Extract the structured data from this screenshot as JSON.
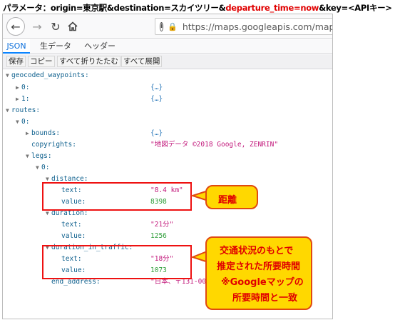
{
  "caption": {
    "prefix": "パラメータ：origin=東京駅&destination=スカイツリー&",
    "highlight": "departure_time=now",
    "suffix": "&key=<APIキー>"
  },
  "toolbar": {
    "back_icon": "arrow-left-icon",
    "forward_icon": "arrow-right-icon",
    "reload_icon": "reload-icon",
    "home_icon": "home-icon",
    "url": "https://maps.googleapis.com/maps"
  },
  "tabs": [
    "JSON",
    "生データ",
    "ヘッダー"
  ],
  "actions": [
    "保存",
    "コピー",
    "すべて折りたたむ",
    "すべて展開"
  ],
  "tree": {
    "geocoded_waypoints": "geocoded_waypoints:",
    "w0": "0:",
    "w0_val": "{…}",
    "w1": "1:",
    "w1_val": "{…}",
    "routes": "routes:",
    "r0": "0:",
    "bounds": "bounds:",
    "bounds_val": "{…}",
    "copyrights": "copyrights:",
    "copyrights_val": "\"地図データ ©2018 Google, ZENRIN\"",
    "legs": "legs:",
    "l0": "0:",
    "distance": "distance:",
    "dist_text": "text:",
    "dist_text_val": "\"8.4 km\"",
    "dist_value": "value:",
    "dist_value_val": "8398",
    "duration": "duration:",
    "dur_text": "text:",
    "dur_text_val": "\"21分\"",
    "dur_value": "value:",
    "dur_value_val": "1256",
    "dit": "duration_in_traffic:",
    "dit_text": "text:",
    "dit_text_val": "\"18分\"",
    "dit_value": "value:",
    "dit_value_val": "1073",
    "end_address": "end_address:",
    "end_address_val": "\"日本、〒131-00"
  },
  "callouts": {
    "distance": "距離",
    "traffic_lines": [
      "交通状況のもとで",
      "推定された所要時間",
      "※Googleマップの",
      "所要時間と一致"
    ]
  },
  "colors": {
    "highlight_red": "#e00000",
    "callout_fill": "#ffd800",
    "callout_border": "#e04a10",
    "tab_active": "#0a84ff"
  }
}
